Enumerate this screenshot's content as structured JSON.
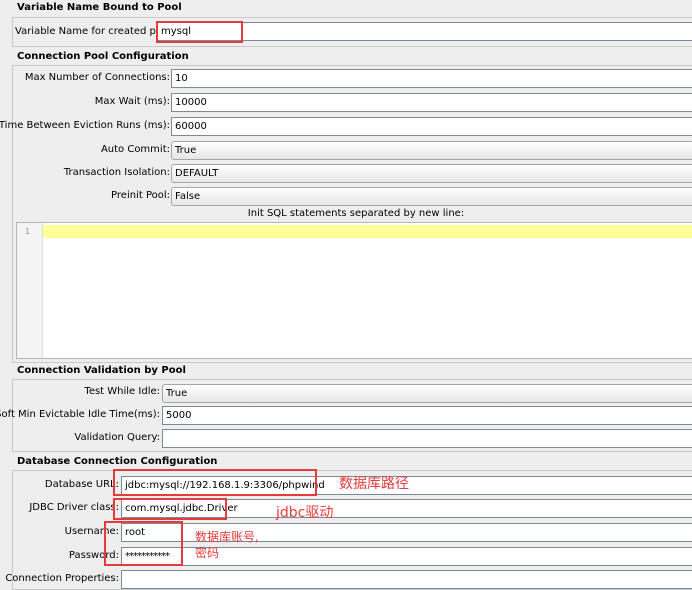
{
  "variable_section": {
    "title": "Variable Name Bound to Pool",
    "label": "Variable Name for created pool:",
    "value": "mysql"
  },
  "pool_section": {
    "title": "Connection Pool Configuration",
    "max_connections_label": "Max Number of Connections:",
    "max_connections_value": "10",
    "max_wait_label": "Max Wait (ms):",
    "max_wait_value": "10000",
    "eviction_label": "Time Between Eviction Runs (ms):",
    "eviction_value": "60000",
    "auto_commit_label": "Auto Commit:",
    "auto_commit_value": "True",
    "isolation_label": "Transaction Isolation:",
    "isolation_value": "DEFAULT",
    "preinit_label": "Preinit Pool:",
    "preinit_value": "False",
    "init_sql_label": "Init SQL statements separated by new line:",
    "init_sql_line_number": "1"
  },
  "validation_section": {
    "title": "Connection Validation by Pool",
    "test_idle_label": "Test While Idle:",
    "test_idle_value": "True",
    "soft_min_label": "Soft Min Evictable Idle Time(ms):",
    "soft_min_value": "5000",
    "validation_query_label": "Validation Query:",
    "validation_query_value": ""
  },
  "db_section": {
    "title": "Database Connection Configuration",
    "url_label": "Database URL:",
    "url_value": "jdbc:mysql://192.168.1.9:3306/phpwind",
    "driver_label": "JDBC Driver class:",
    "driver_value": "com.mysql.jdbc.Driver",
    "username_label": "Username:",
    "username_value": "root",
    "password_label": "Password:",
    "password_value": "***********",
    "properties_label": "Connection Properties:"
  },
  "annotations": {
    "url_note": "数据库路径",
    "driver_note": "jdbc驱动",
    "account_note_line1": "数据库账号,",
    "account_note_line2": "密码"
  },
  "colors": {
    "annotation_red": "#e53b3b",
    "highlight_line": "#ffff99"
  }
}
